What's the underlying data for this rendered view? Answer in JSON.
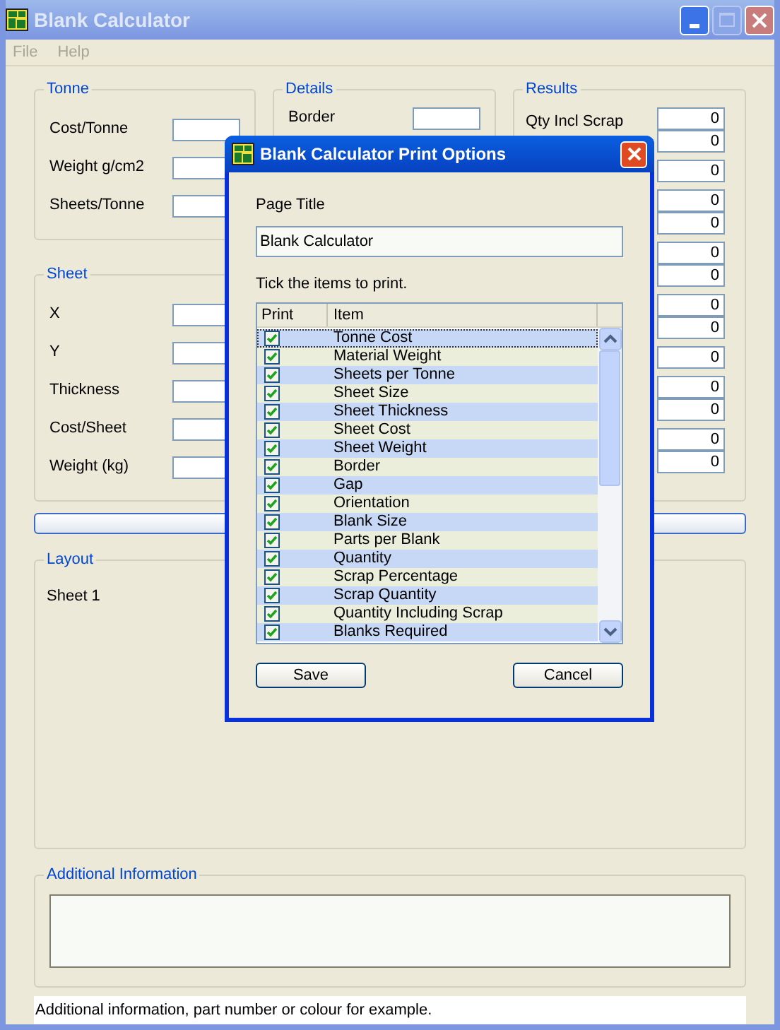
{
  "window": {
    "title": "Blank Calculator",
    "active": false
  },
  "menu": [
    "File",
    "Help"
  ],
  "tonne": {
    "title": "Tonne",
    "fields": [
      "Cost/Tonne",
      "Weight g/cm2",
      "Sheets/Tonne"
    ]
  },
  "sheet": {
    "title": "Sheet",
    "fields": [
      "X",
      "Y",
      "Thickness",
      "Cost/Sheet",
      "Weight (kg)"
    ]
  },
  "details": {
    "title": "Details",
    "fields": [
      "Border"
    ]
  },
  "results": {
    "title": "Results",
    "groups": [
      {
        "label": "Qty Incl Scrap",
        "values": [
          "0",
          "0"
        ]
      },
      {
        "values": [
          "0"
        ]
      },
      {
        "values": [
          "0",
          "0"
        ]
      },
      {
        "values": [
          "0",
          "0"
        ]
      },
      {
        "values": [
          "0",
          "0"
        ]
      },
      {
        "values": [
          "0"
        ]
      },
      {
        "values": [
          "0",
          "0"
        ]
      },
      {
        "values": [
          "0",
          "0"
        ]
      }
    ]
  },
  "layout": {
    "title": "Layout",
    "text": "Sheet 1"
  },
  "additional": {
    "title": "Additional Information"
  },
  "status_bar": "Additional information, part number or colour for example.",
  "dialog": {
    "title": "Blank Calculator Print Options",
    "page_title_label": "Page Title",
    "page_title_value": "Blank Calculator",
    "instruction": "Tick the items to print.",
    "columns": [
      "Print",
      "Item"
    ],
    "rows": [
      {
        "label": "Tonne Cost",
        "checked": true,
        "focused": true
      },
      {
        "label": "Material Weight",
        "checked": true,
        "focused": false
      },
      {
        "label": "Sheets per Tonne",
        "checked": true,
        "focused": false
      },
      {
        "label": "Sheet Size",
        "checked": true,
        "focused": false
      },
      {
        "label": "Sheet Thickness",
        "checked": true,
        "focused": false
      },
      {
        "label": "Sheet Cost",
        "checked": true,
        "focused": false
      },
      {
        "label": "Sheet Weight",
        "checked": true,
        "focused": false
      },
      {
        "label": "Border",
        "checked": true,
        "focused": false
      },
      {
        "label": "Gap",
        "checked": true,
        "focused": false
      },
      {
        "label": "Orientation",
        "checked": true,
        "focused": false
      },
      {
        "label": "Blank Size",
        "checked": true,
        "focused": false
      },
      {
        "label": "Parts per Blank",
        "checked": true,
        "focused": false
      },
      {
        "label": "Quantity",
        "checked": true,
        "focused": false
      },
      {
        "label": "Scrap Percentage",
        "checked": true,
        "focused": false
      },
      {
        "label": "Scrap Quantity",
        "checked": true,
        "focused": false
      },
      {
        "label": "Quantity Including Scrap",
        "checked": true,
        "focused": false
      },
      {
        "label": "Blanks Required",
        "checked": true,
        "focused": false
      }
    ],
    "buttons": [
      "Save",
      "Cancel"
    ]
  }
}
